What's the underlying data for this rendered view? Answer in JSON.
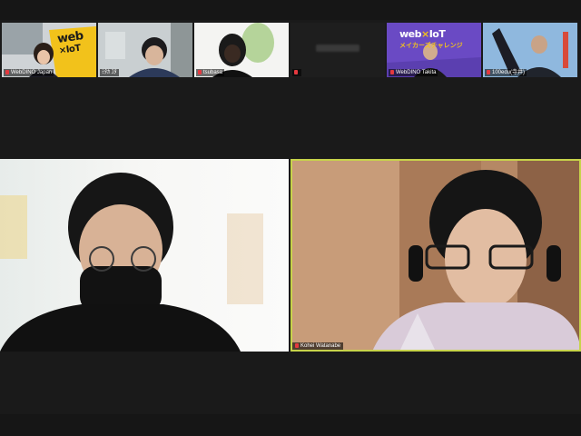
{
  "participants": [
    {
      "id": "p1",
      "label": "WebDINO Japan",
      "muted": true
    },
    {
      "id": "p2",
      "label": "ﾐﾀｶ ﾕﾀ",
      "muted": false
    },
    {
      "id": "p3",
      "label": "tsubasa",
      "muted": true
    },
    {
      "id": "p4",
      "label": "",
      "muted": true
    },
    {
      "id": "p5",
      "label": "WebDINO Takita",
      "muted": true
    },
    {
      "id": "p6",
      "label": "100edu(寺井)",
      "muted": true
    }
  ],
  "stage": [
    {
      "id": "s1",
      "label": "",
      "muted": false,
      "active": false
    },
    {
      "id": "s2",
      "label": "Kohei Watanabe",
      "muted": true,
      "active": true
    }
  ],
  "logo": {
    "line1": "web",
    "line2": "IoT",
    "x": "×",
    "sub": "メイカーズチャレンジ"
  },
  "colors": {
    "background": "#1a1a1a",
    "active_speaker": "#c7d34a",
    "muted_icon": "#e5393f",
    "logo_yellow": "#f2c21b",
    "logo_purple": "#5b3fb0"
  }
}
